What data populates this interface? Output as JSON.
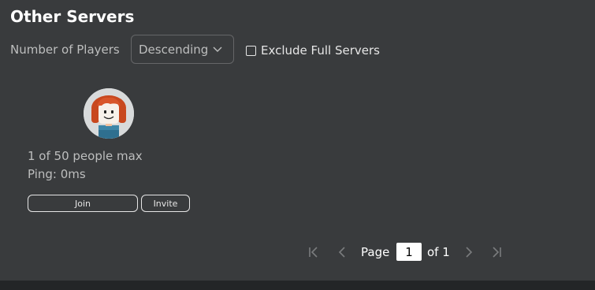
{
  "section": {
    "title": "Other Servers"
  },
  "sort": {
    "label": "Number of Players",
    "selected": "Descending"
  },
  "filter": {
    "exclude_label": "Exclude Full Servers",
    "checked": false
  },
  "server": {
    "players_text": "1 of 50 people max",
    "ping_text": "Ping: 0ms",
    "join_label": "Join",
    "invite_label": "Invite",
    "avatar_icon": "avatar-icon"
  },
  "pagination": {
    "page_label": "Page",
    "current_page": "1",
    "of_label": "of 1"
  },
  "colors": {
    "background": "#393b3d",
    "text_muted": "#bdbebe",
    "border": "#e6e6e6"
  }
}
